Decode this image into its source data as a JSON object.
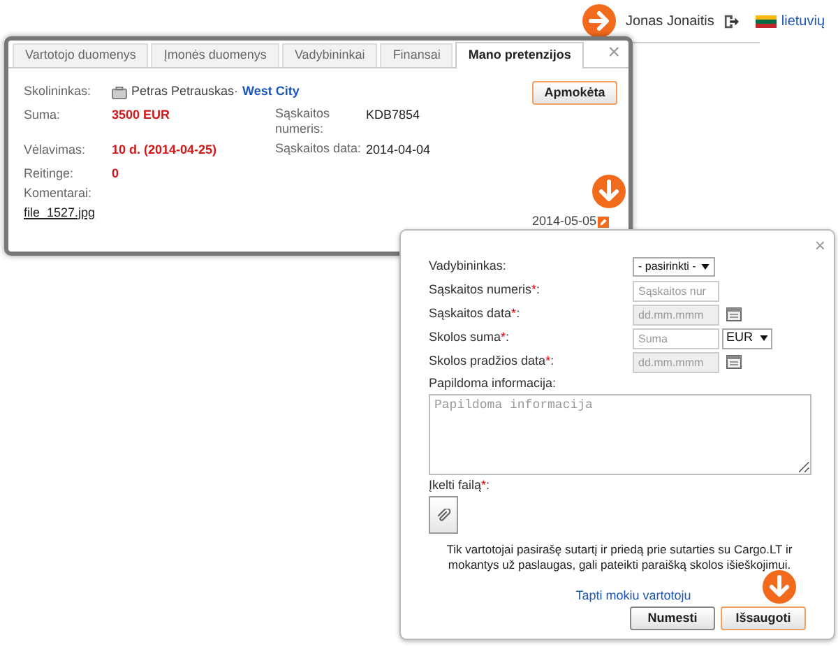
{
  "header": {
    "user_name": "Jonas Jonaitis",
    "language": "lietuvių"
  },
  "claim_window": {
    "tabs": [
      {
        "label": "Vartotojo duomenys",
        "selected": false
      },
      {
        "label": "Įmonės duomenys",
        "selected": false
      },
      {
        "label": "Vadybininkai",
        "selected": false
      },
      {
        "label": "Finansai",
        "selected": false
      },
      {
        "label": "Mano pretenzijos",
        "selected": true
      }
    ],
    "close": "×",
    "debtor": {
      "label": "Skolininkas:",
      "name": "Petras Petrauskas·",
      "city": "West City"
    },
    "rows": [
      {
        "label": "Suma:",
        "value": "3500 EUR",
        "alert": true,
        "side_label": "Sąskaitos numeris:",
        "side_value": "KDB7854"
      },
      {
        "label": "Vėlavimas:",
        "value": "10 d. (2014-04-25)",
        "alert": true,
        "side_label": "Sąskaitos data:",
        "side_value": "2014-04-04"
      },
      {
        "label": "Reitinge:",
        "value": "0",
        "alert": true
      }
    ],
    "comments_label": "Komentarai:",
    "file": "file_1527.jpg",
    "paid_button": {
      "label": "Apmokėta",
      "primary": true
    },
    "date": "2014-05-05"
  },
  "claim_form": {
    "close": "×",
    "fields": [
      {
        "kind": "select",
        "label": "Vadybininkas:",
        "value": "- pasirinkti -"
      },
      {
        "kind": "input",
        "label": "Sąskaitos numeris",
        "mark": "*",
        "suffix": ":",
        "placeholder": "Sąskaitos nur"
      },
      {
        "kind": "date",
        "label": "Sąskaitos data",
        "mark": "*",
        "suffix": ":",
        "placeholder": "dd.mm.mmm"
      },
      {
        "kind": "money",
        "label": "Skolos suma",
        "mark": "*",
        "suffix": ":",
        "placeholder": "Suma",
        "currency": "EUR"
      },
      {
        "kind": "date",
        "label": "Skolos pradžios data",
        "mark": "*",
        "suffix": ":",
        "placeholder": "dd.mm.mmm"
      }
    ],
    "notes_label": "Papildoma informacija:",
    "notes_placeholder": "Papildoma informacija",
    "upload_label": {
      "label": "Įkelti failą",
      "mark": "*",
      "suffix": ":"
    },
    "notice": "Tik vartotojai pasirašę sutartį ir priedą prie sutarties su Cargo.LT ir mokantys už paslaugas, gali pateikti paraišką skolos išieškojimui.",
    "link": "Tapti mokiu vartotoju",
    "buttons": [
      {
        "label": "Numesti",
        "primary": false
      },
      {
        "label": "Išsaugoti",
        "primary": true
      }
    ]
  }
}
